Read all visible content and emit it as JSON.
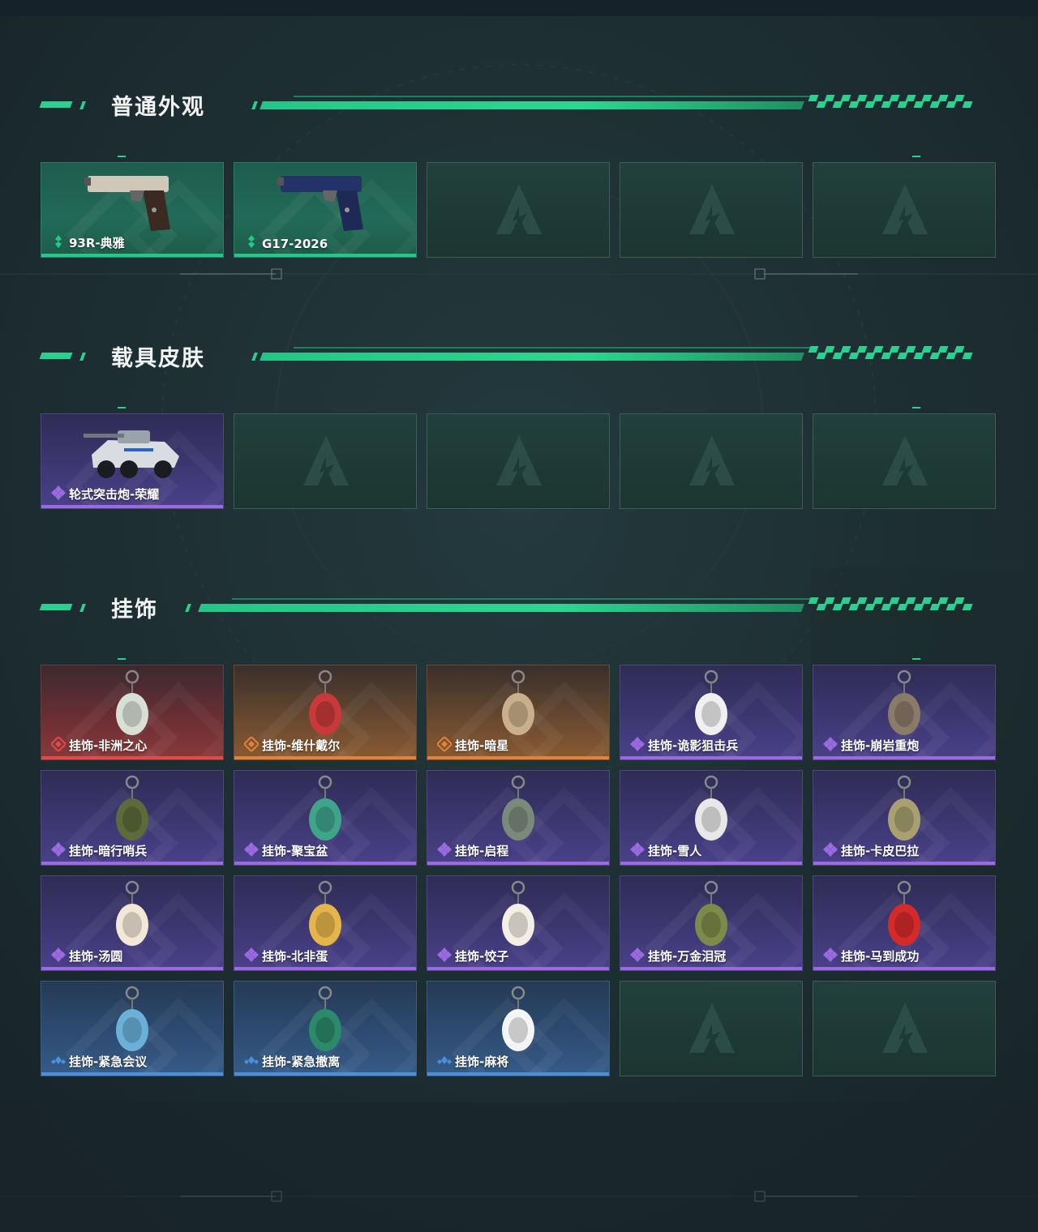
{
  "sections": [
    {
      "title": "普通外观",
      "items": [
        {
          "name": "93R-典雅",
          "rarity": "green",
          "icon": "pistol-icon"
        },
        {
          "name": "G17-2026",
          "rarity": "green",
          "icon": "pistol-icon"
        },
        {
          "name": "",
          "rarity": "empty"
        },
        {
          "name": "",
          "rarity": "empty"
        },
        {
          "name": "",
          "rarity": "empty"
        }
      ]
    },
    {
      "title": "载具皮肤",
      "items": [
        {
          "name": "轮式突击炮-荣耀",
          "rarity": "purple",
          "icon": "vehicle-icon"
        },
        {
          "name": "",
          "rarity": "empty"
        },
        {
          "name": "",
          "rarity": "empty"
        },
        {
          "name": "",
          "rarity": "empty"
        },
        {
          "name": "",
          "rarity": "empty"
        }
      ]
    },
    {
      "title": "挂饰",
      "items": [
        {
          "name": "挂饰-非洲之心",
          "rarity": "red",
          "icon": "charm-icon"
        },
        {
          "name": "挂饰-维什戴尔",
          "rarity": "orange",
          "icon": "charm-icon"
        },
        {
          "name": "挂饰-暗星",
          "rarity": "orange",
          "icon": "charm-icon"
        },
        {
          "name": "挂饰-诡影狙击兵",
          "rarity": "purple",
          "icon": "charm-icon"
        },
        {
          "name": "挂饰-崩岩重炮",
          "rarity": "purple",
          "icon": "charm-icon"
        },
        {
          "name": "挂饰-暗行哨兵",
          "rarity": "purple",
          "icon": "charm-icon"
        },
        {
          "name": "挂饰-聚宝盆",
          "rarity": "purple",
          "icon": "charm-icon"
        },
        {
          "name": "挂饰-启程",
          "rarity": "purple",
          "icon": "charm-icon"
        },
        {
          "name": "挂饰-雪人",
          "rarity": "purple",
          "icon": "charm-icon"
        },
        {
          "name": "挂饰-卡皮巴拉",
          "rarity": "purple",
          "icon": "charm-icon"
        },
        {
          "name": "挂饰-汤圆",
          "rarity": "purple",
          "icon": "charm-icon"
        },
        {
          "name": "挂饰-北非蛋",
          "rarity": "purple",
          "icon": "charm-icon"
        },
        {
          "name": "挂饰-饺子",
          "rarity": "purple",
          "icon": "charm-icon"
        },
        {
          "name": "挂饰-万金泪冠",
          "rarity": "purple",
          "icon": "charm-icon"
        },
        {
          "name": "挂饰-马到成功",
          "rarity": "purple",
          "icon": "charm-icon"
        },
        {
          "name": "挂饰-紧急会议",
          "rarity": "blue",
          "icon": "charm-icon"
        },
        {
          "name": "挂饰-紧急撤离",
          "rarity": "blue",
          "icon": "charm-icon"
        },
        {
          "name": "挂饰-麻将",
          "rarity": "blue",
          "icon": "charm-icon"
        },
        {
          "name": "",
          "rarity": "empty"
        },
        {
          "name": "",
          "rarity": "empty"
        }
      ]
    }
  ],
  "colors": {
    "accent": "#2ad08e",
    "green": "#22c98d",
    "purple": "#9b6ae0",
    "red": "#e04a4a",
    "orange": "#e4813a",
    "blue": "#4b8fe0"
  }
}
